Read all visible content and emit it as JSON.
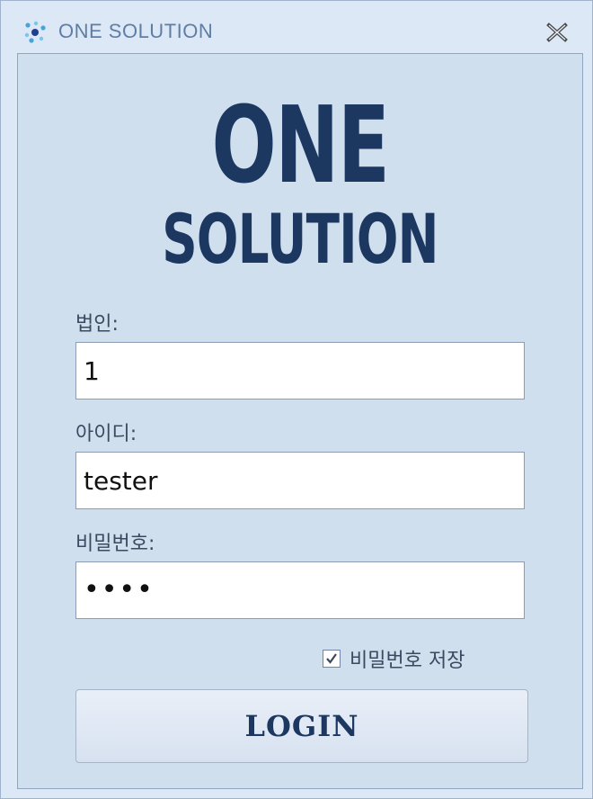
{
  "window": {
    "title": "ONE SOLUTION",
    "icon": "dots-logo-icon",
    "close_icon": "close-icon"
  },
  "logo": {
    "line1": "ONE",
    "line2": "SOLUTION",
    "color": "#1c3760"
  },
  "form": {
    "corp_label": "법인:",
    "corp_value": "1",
    "id_label": "아이디:",
    "id_value": "tester",
    "password_label": "비밀번호:",
    "password_value": "••••",
    "remember_label": "비밀번호 저장",
    "remember_checked": true
  },
  "login_button": {
    "label": "LOGIN"
  },
  "colors": {
    "background": "#dce8f5",
    "panel": "#cfdfee",
    "accent": "#1c3760",
    "title_text": "#5f7ea6"
  }
}
